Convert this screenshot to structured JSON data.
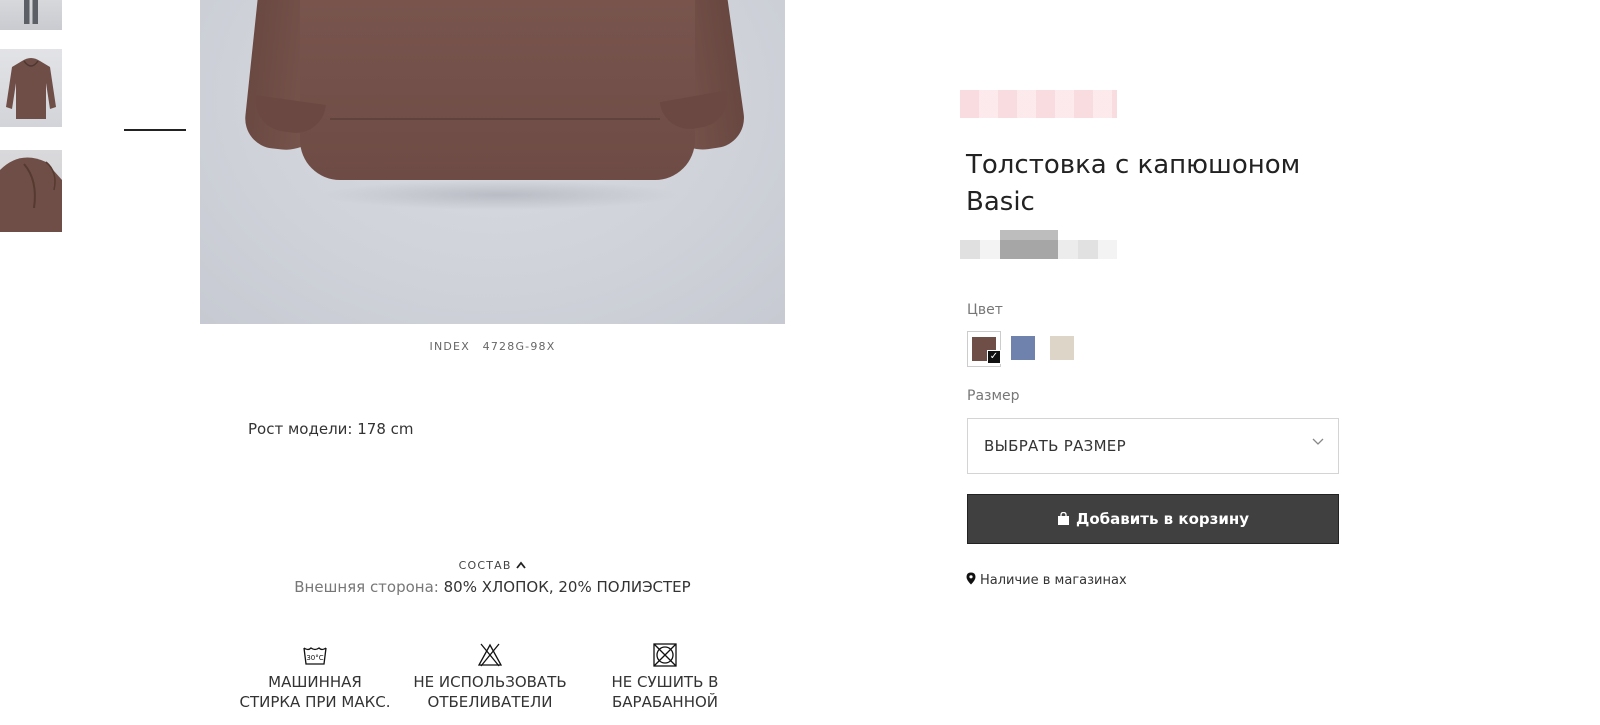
{
  "gallery": {
    "thumbnails": [
      {
        "alt": "model legs photo"
      },
      {
        "alt": "hoodie front photo",
        "active": true
      },
      {
        "alt": "hoodie detail photo"
      }
    ]
  },
  "product": {
    "index_label": "INDEX",
    "index_value": "4728G-98X",
    "model_height": "Рост модели: 178 cm",
    "composition_title": "СОСТАВ",
    "composition_key": "Внешняя сторона:",
    "composition_value": "80% ХЛОПОК, 20% ПОЛИЭСТЕР",
    "care": [
      {
        "icon": "wash-30-icon",
        "line1": "МАШИННАЯ",
        "line2": "СТИРКА ПРИ МАКС."
      },
      {
        "icon": "no-bleach-icon",
        "line1": "НЕ ИСПОЛЬЗОВАТЬ",
        "line2": "ОТБЕЛИВАТЕЛИ"
      },
      {
        "icon": "no-tumble-dry-icon",
        "line1": "НЕ СУШИТЬ В",
        "line2": "БАРАБАННОЙ"
      }
    ]
  },
  "panel": {
    "title_line1": "Толстовка с капюшоном",
    "title_line2": "Basic",
    "color_label": "Цвет",
    "colors": [
      {
        "name": "brown",
        "hex": "#6f4e48",
        "selected": true
      },
      {
        "name": "blue",
        "hex": "#6f82ad"
      },
      {
        "name": "beige",
        "hex": "#ddd6c8"
      }
    ],
    "size_label": "Размер",
    "size_placeholder": "ВЫБРАТЬ РАЗМЕР",
    "add_to_cart": "Добавить в корзину",
    "store_availability": "Наличие в магазинах"
  },
  "colors": {
    "button_bg": "#404040",
    "text": "#222222",
    "muted": "#777777"
  }
}
